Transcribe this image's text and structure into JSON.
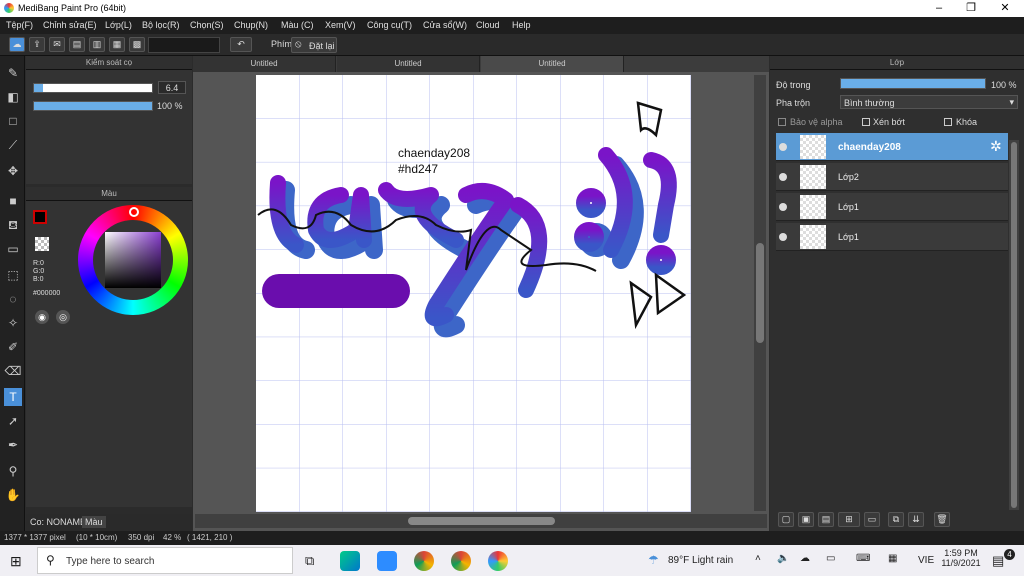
{
  "window": {
    "title": "MediBang Paint Pro (64bit)"
  },
  "menu": [
    "Tệp(F)",
    "Chỉnh sửa(E)",
    "Lớp(L)",
    "Bộ lọc(R)",
    "Chọn(S)",
    "Chụp(N)",
    "Màu (C)",
    "Xem(V)",
    "Công cụ(T)",
    "Cửa sổ(W)",
    "Cloud",
    "Help"
  ],
  "toolbar": {
    "shortcut_label": "Phím",
    "reset_label": "Đặt lại"
  },
  "brush_panel": {
    "title": "Kiểm soát cọ",
    "size_value": "6.4",
    "opacity_value": "100 %",
    "opacity_fraction": 1.0,
    "size_fraction": 0.08
  },
  "color_panel": {
    "title": "Màu",
    "r": "R:0",
    "g": "G:0",
    "b": "B:0",
    "hex": "#000000",
    "current_color": "#000000"
  },
  "tabs": [
    {
      "label": "Untitled"
    },
    {
      "label": "Untitled"
    },
    {
      "label": "Untitled"
    }
  ],
  "canvas": {
    "text_line1": "chaenday208",
    "text_line2": "#hd247"
  },
  "layer_panel": {
    "title": "Lớp",
    "opacity_label": "Độ trong",
    "opacity_value": "100 %",
    "blend_label": "Pha trộn",
    "blend_value": "Bình thường",
    "protect_alpha": "Bảo vệ alpha",
    "clip": "Xén bớt",
    "lock": "Khóa",
    "layers": [
      {
        "name": "chaenday208",
        "selected": true
      },
      {
        "name": "Lớp2",
        "selected": false
      },
      {
        "name": "Lớp1",
        "selected": false
      },
      {
        "name": "Lớp1",
        "selected": false
      }
    ]
  },
  "status": {
    "dims": "1377 * 1377 pixel",
    "size": "(10 * 10cm)",
    "dpi": "350 dpi",
    "zoom": "42 %",
    "coords": "( 1421, 210 )"
  },
  "left_bottom": {
    "co_label": "Co: NONAME",
    "mau_tab": "Màu"
  },
  "taskbar": {
    "search_placeholder": "Type here to search",
    "weather": "89°F  Light rain",
    "lang": "VIE",
    "time": "1:59 PM",
    "date": "11/9/2021",
    "notif_count": "4"
  },
  "colors": {
    "accent": "#5b9bd5",
    "purple": "#6a0dad",
    "blue": "#3a5fc8"
  }
}
